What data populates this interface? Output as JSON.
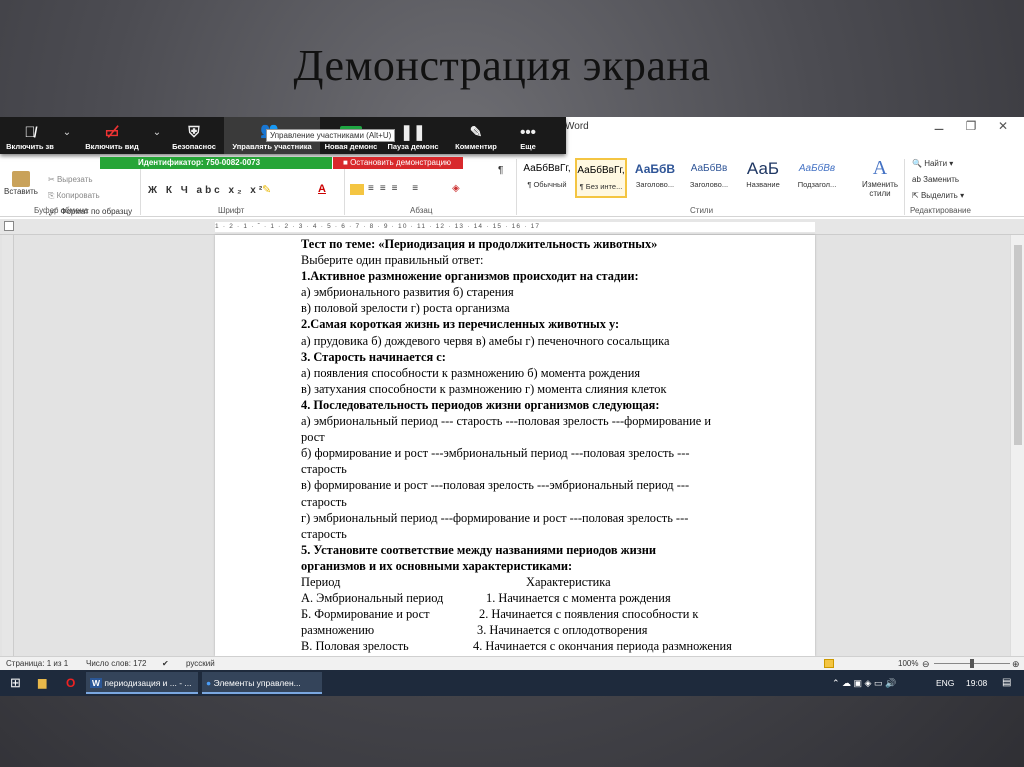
{
  "slide": {
    "title": "Демонстрация экрана"
  },
  "window": {
    "app_title": "Word",
    "controls": [
      "⚊",
      "❐",
      "✕"
    ]
  },
  "zoom": {
    "buttons": [
      {
        "label": "Включить зв",
        "icon": "muted-microphone-icon"
      },
      {
        "label": "Включить вид",
        "icon": "video-off-icon"
      },
      {
        "label": "Безопаснос",
        "icon": "shield-icon"
      },
      {
        "label": "Управлять участника",
        "icon": "participants-icon",
        "count": "1"
      },
      {
        "label": "Новая демонс",
        "icon": "share-screen-icon"
      },
      {
        "label": "Пауза демонс",
        "icon": "pause-icon"
      },
      {
        "label": "Комментир",
        "icon": "pen-icon"
      },
      {
        "label": "Еще",
        "icon": "more-icon"
      }
    ],
    "tooltip": "Управление участниками (Alt+U)",
    "meeting_id": "Идентификатор: 750-0082-0073",
    "stop_share": "Остановить демонстрацию"
  },
  "ribbon": {
    "clipboard": {
      "paste": "Вставить",
      "cut": "Вырезать",
      "copy": "Копировать",
      "format_painter": "Формат по образцу",
      "group": "Буфер обмена"
    },
    "font": {
      "group": "Шрифт",
      "buttons": "Ж  К  Ч  abc  x₂  x²"
    },
    "paragraph": {
      "group": "Абзац"
    },
    "styles": {
      "group": "Стили",
      "items": [
        {
          "preview": "АаБбВвГг,",
          "name": "¶ Обычный"
        },
        {
          "preview": "АаБбВвГг,",
          "name": "¶ Без инте..."
        },
        {
          "preview": "АаБбВ",
          "name": "Заголово..."
        },
        {
          "preview": "АаБбВв",
          "name": "Заголово..."
        },
        {
          "preview": "АаБ",
          "name": "Название"
        },
        {
          "preview": "АаБбВв",
          "name": "Подзагол..."
        }
      ],
      "change": "Изменить стили"
    },
    "editing": {
      "find": "Найти",
      "replace": "Заменить",
      "select": "Выделить",
      "group": "Редактирование"
    }
  },
  "ruler": {
    "marks": "1 · 2 · 1 · ˇ · 1 · 2 · 3 · 4 · 5 · 6 · 7 · 8 · 9 · 10 · 11 · 12 · 13 · 14 · 15 · 16 · 17"
  },
  "document": {
    "lines": [
      {
        "text": "Тест по теме: «Периодизация и продолжительность животных»",
        "bold": true
      },
      {
        "text": "Выберите один правильный ответ:",
        "bold": false
      },
      {
        "text": "1.Активное размножение организмов происходит на стадии:",
        "bold": true
      },
      {
        "text": "а) эмбрионального развития   б) старения",
        "bold": false
      },
      {
        "text": "в) половой зрелости   г) роста организма",
        "bold": false
      },
      {
        "text": "2.Самая короткая жизнь из перечисленных животных у:",
        "bold": true
      },
      {
        "text": "а) прудовика   б) дождевого червя   в) амебы   г) печеночного сосальщика",
        "bold": false
      },
      {
        "text": "3. Старость начинается с:",
        "bold": true
      },
      {
        "text": "а) появления способности к размножению  б) момента рождения",
        "bold": false
      },
      {
        "text": "в) затухания способности к размножению  г) момента слияния клеток",
        "bold": false
      },
      {
        "text": "4. Последовательность периодов жизни организмов следующая:",
        "bold": true
      },
      {
        "text": "а) эмбриональный период --- старость ---половая зрелость ---формирование и",
        "bold": false
      },
      {
        "text": "рост",
        "bold": false
      },
      {
        "text": "б) формирование и рост ---эмбриональный период ---половая зрелость ---",
        "bold": false
      },
      {
        "text": "старость",
        "bold": false
      },
      {
        "text": "в) формирование и рост ---половая зрелость ---эмбриональный период ---",
        "bold": false
      },
      {
        "text": "старость",
        "bold": false
      },
      {
        "text": "г) эмбриональный период ---формирование и рост ---половая зрелость ---",
        "bold": false
      },
      {
        "text": "старость",
        "bold": false
      },
      {
        "text": "5. Установите соответствие между названиями периодов жизни",
        "bold": true
      },
      {
        "text": "организмов и их основными характеристиками:",
        "bold": true
      }
    ],
    "table": [
      {
        "left": "Период",
        "right": "Характеристика",
        "indent": 225
      },
      {
        "left": "А. Эмбриональный период",
        "right": "1. Начинается с момента рождения",
        "indent": 185
      },
      {
        "left": "Б. Формирование и рост",
        "right": "2. Начинается с появления способности к",
        "indent": 178
      },
      {
        "left": "размножению",
        "right": "3. Начинается с оплодотворения",
        "indent": 176
      },
      {
        "left": "В. Половая зрелость",
        "right": "4. Начинается с окончания периода размножения",
        "indent": 172
      }
    ]
  },
  "status": {
    "page": "Страница: 1 из 1",
    "words": "Число слов: 172",
    "lang": "русский",
    "zoom": "100%"
  },
  "taskbar": {
    "items": [
      "периодизация и ... - ...",
      "Элементы управлен..."
    ],
    "lang": "ENG",
    "time": "19:08"
  }
}
